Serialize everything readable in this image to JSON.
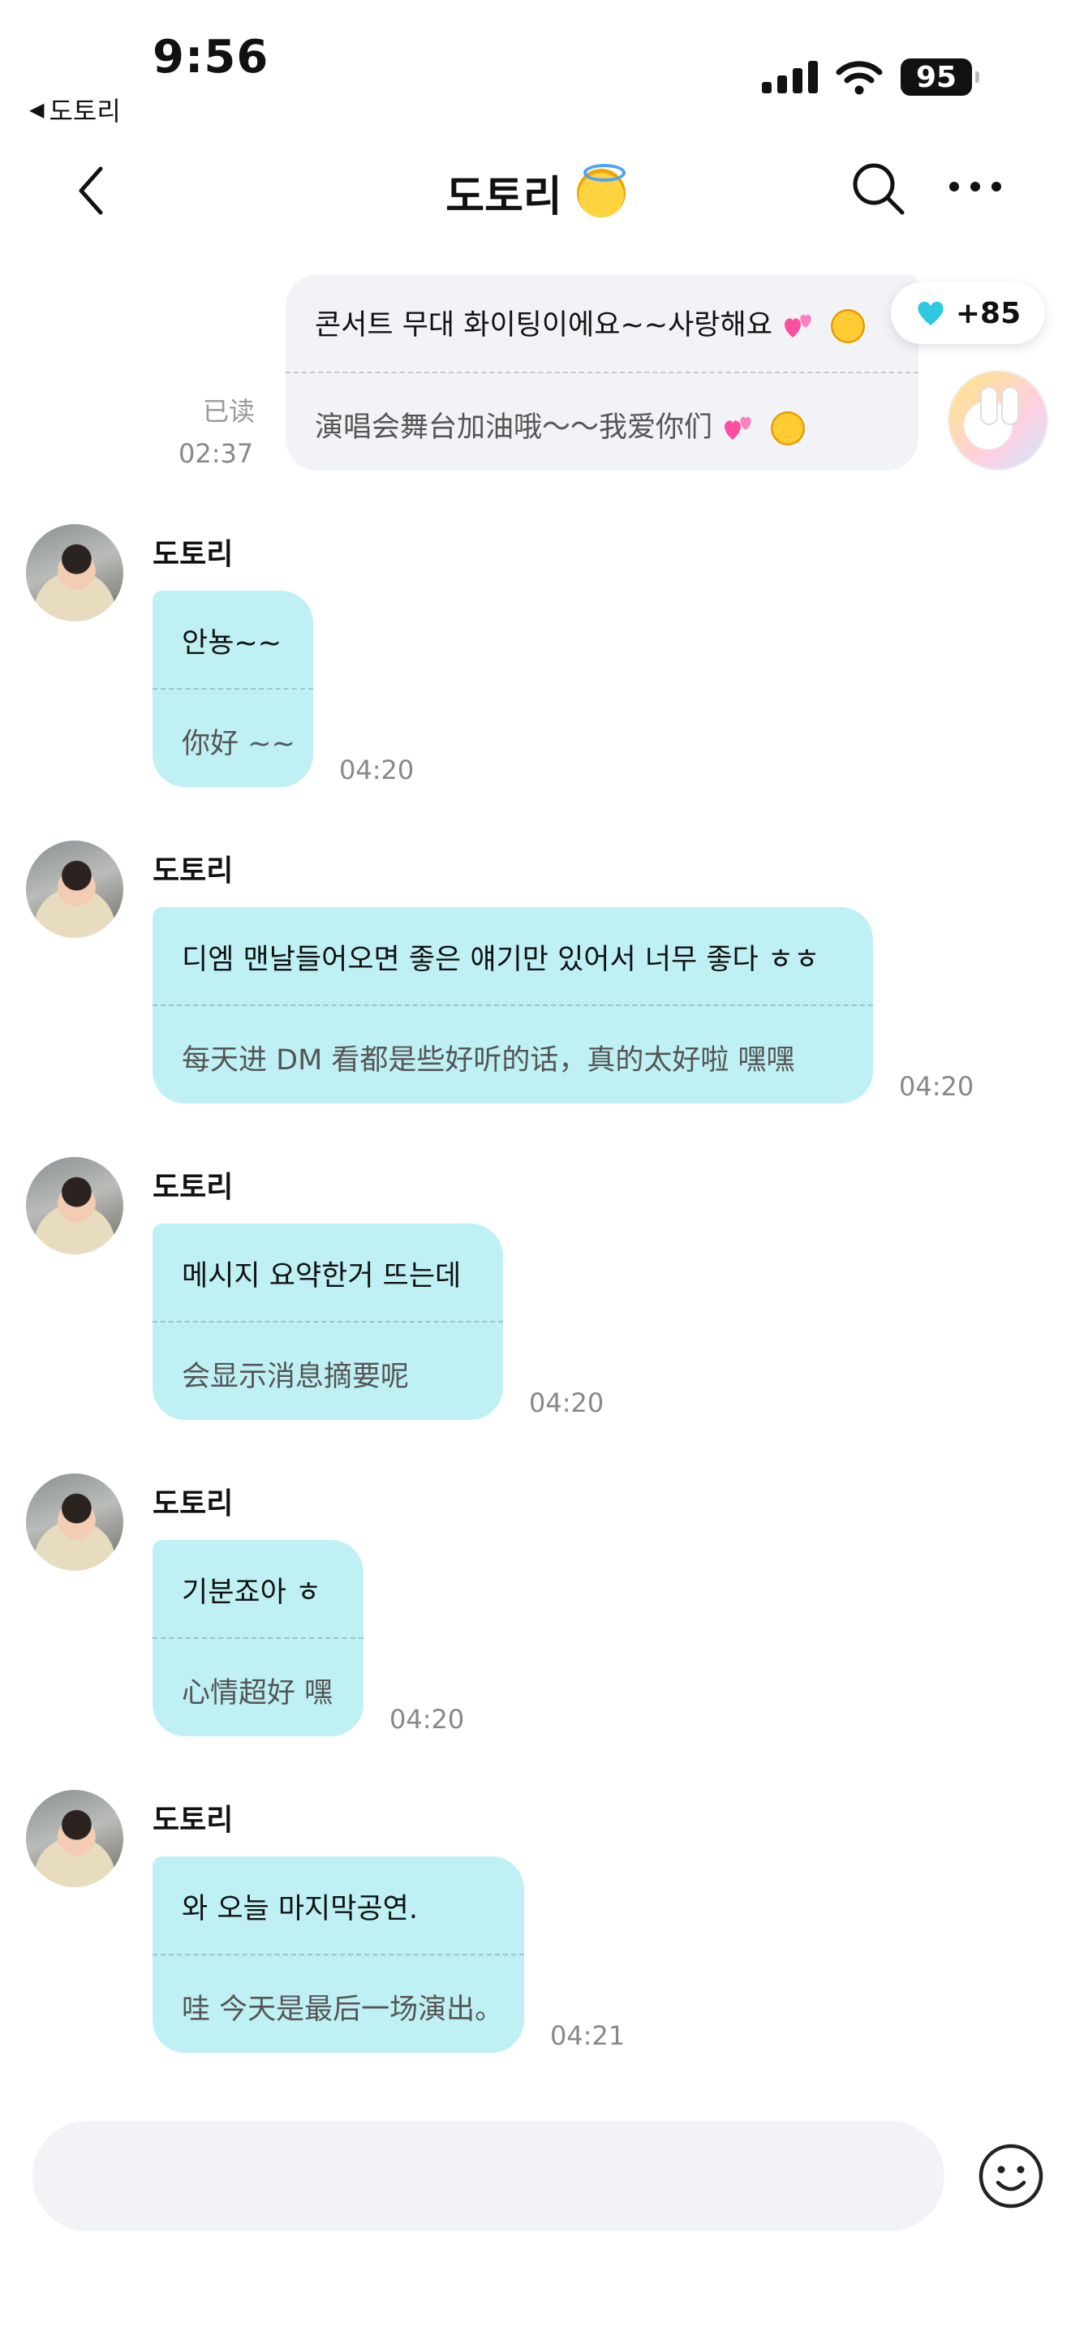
{
  "status_bar": {
    "time": "9:56",
    "back_app": "도토리",
    "battery": "95"
  },
  "header": {
    "title": "도토리"
  },
  "sent_message": {
    "korean": "콘서트 무대 화이팅이에요~~사랑해요",
    "chinese": "演唱会舞台加油哦～～我爱你们",
    "read_status": "已读",
    "time": "02:37",
    "likes": "+85"
  },
  "messages": [
    {
      "sender": "도토리",
      "korean": "안뇽~~",
      "chinese": "你好 ~~",
      "time": "04:20"
    },
    {
      "sender": "도토리",
      "korean": "디엠 맨날들어오면 좋은 얘기만 있어서 너무 좋다 ㅎㅎ",
      "chinese": "每天进 DM 看都是些好听的话，真的太好啦 嘿嘿",
      "time": "04:20"
    },
    {
      "sender": "도토리",
      "korean": "메시지 요약한거 뜨는데",
      "chinese": "会显示消息摘要呢",
      "time": "04:20"
    },
    {
      "sender": "도토리",
      "korean": "기분죠아 ㅎ",
      "chinese": "心情超好 嘿",
      "time": "04:20"
    },
    {
      "sender": "도토리",
      "korean": "와 오늘 마지막공연.",
      "chinese": "哇 今天是最后一场演出。",
      "time": "04:21"
    }
  ],
  "colors": {
    "received_bubble": "#bff1f4",
    "sent_bubble": "#f1f3f7",
    "like_heart": "#2ec8e0"
  },
  "icons": [
    "back-chevron-icon",
    "search-icon",
    "more-icon",
    "heart-icon",
    "smiley-icon"
  ]
}
